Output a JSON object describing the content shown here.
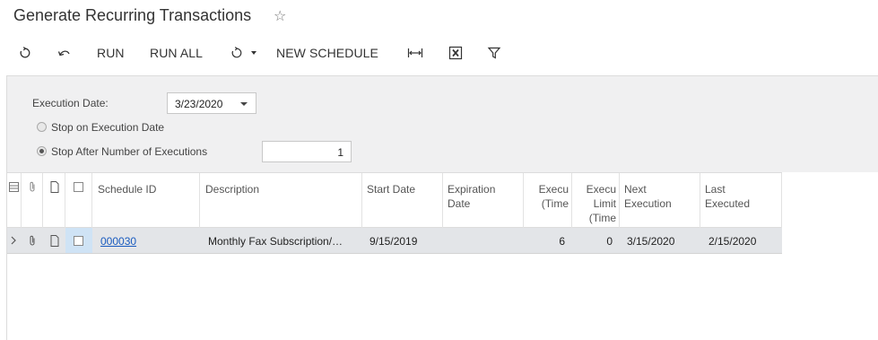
{
  "page": {
    "title": "Generate Recurring Transactions"
  },
  "toolbar": {
    "run_label": "RUN",
    "run_all_label": "RUN ALL",
    "new_schedule_label": "NEW SCHEDULE"
  },
  "filter": {
    "execution_date_label": "Execution Date:",
    "execution_date_value": "3/23/2020",
    "stop_on_date_label": "Stop on Execution Date",
    "stop_after_label": "Stop After Number of Executions",
    "number_of_executions": "1",
    "selected_option": "stop_after"
  },
  "grid": {
    "columns": {
      "schedule_id": "Schedule ID",
      "description": "Description",
      "start_date": "Start Date",
      "expiration_date_line1": "Expiration",
      "expiration_date_line2": "Date",
      "exec_times_line1": "Execu",
      "exec_times_line2": "(Time",
      "exec_limit_line1": "Execu",
      "exec_limit_line2": "Limit",
      "exec_limit_line3": "(Time",
      "next_execution_line1": "Next",
      "next_execution_line2": "Execution",
      "last_executed_line1": "Last",
      "last_executed_line2": "Executed"
    },
    "rows": [
      {
        "schedule_id": "000030",
        "description": "Monthly Fax Subscription/…",
        "start_date": "9/15/2019",
        "expiration_date": "",
        "exec_times": "6",
        "exec_limit": "0",
        "next_execution": "3/15/2020",
        "last_executed": "2/15/2020"
      }
    ]
  },
  "colors": {
    "link": "#1a5bbf",
    "panel_bg": "#f0f0f1",
    "row_bg": "#e3e5e8",
    "selected_cell": "#cfe3f5"
  }
}
